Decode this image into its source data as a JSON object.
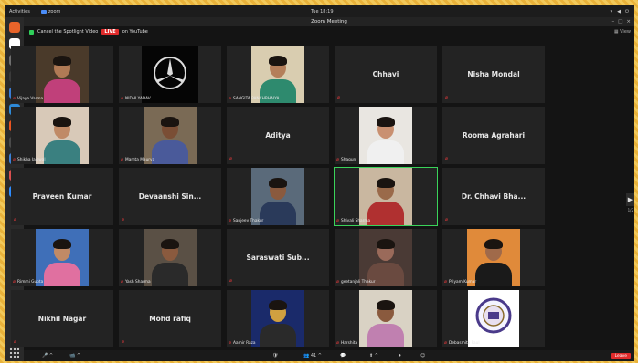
{
  "topbar": {
    "activities": "Activities",
    "app_name": "zoom",
    "clock": "Tue 18:19",
    "tray": [
      "▾",
      "◀",
      "⏻"
    ]
  },
  "window": {
    "title": "Zoom Meeting"
  },
  "spotlight_bar": {
    "cancel_label": "Cancel the Spotlight Video",
    "live_badge": "LIVE",
    "live_target": "on YouTube",
    "view_label": "▦ View"
  },
  "dock": {
    "apps": [
      {
        "name": "firefox",
        "color": "#e8642a"
      },
      {
        "name": "chrome",
        "color": "#ffffff"
      },
      {
        "name": "files",
        "color": "#6e6e6e"
      },
      {
        "name": "terminal-dark",
        "color": "#3a3a3a"
      },
      {
        "name": "thunderbird",
        "color": "#3a7bd5"
      },
      {
        "name": "document",
        "color": "#2e8ad8"
      },
      {
        "name": "software",
        "color": "#e95420"
      },
      {
        "name": "terminal",
        "color": "#4a4a4a"
      },
      {
        "name": "help",
        "color": "#3d80d6"
      },
      {
        "name": "settings",
        "color": "#d94f4f"
      },
      {
        "name": "zoom",
        "color": "#2d8cff"
      }
    ]
  },
  "participants": [
    {
      "name": "Vijaya Varma",
      "label": "Vijaya Varma",
      "has_video": true,
      "bg": "#4a3a2a",
      "skin": "#b07a55",
      "cloth": "#c0407a"
    },
    {
      "name": "NIDHI YADAV",
      "label": "NIDHI YADAV",
      "has_video": true,
      "logo": true
    },
    {
      "name": "SANGITA PANCHBHAIYA",
      "label": "SANGITA PANCHBHAIYA",
      "has_video": true,
      "bg": "#d9cdb0",
      "skin": "#b47f5a",
      "cloth": "#2e8a6e"
    },
    {
      "name": "Chhavi",
      "has_video": false
    },
    {
      "name": "Nisha Mondal",
      "has_video": false
    },
    {
      "name": "Shikha Jaiswal",
      "label": "Shikha Jaiswal",
      "has_video": true,
      "bg": "#d8c9b8",
      "skin": "#c08a66",
      "cloth": "#3a8080"
    },
    {
      "name": "Mamta Maurya",
      "label": "Mamta Maurya",
      "has_video": true,
      "bg": "#7a6a55",
      "skin": "#7a4e35",
      "cloth": "#4a5a9a"
    },
    {
      "name": "Aditya",
      "has_video": false
    },
    {
      "name": "Shagun",
      "label": "Shagun",
      "has_video": true,
      "bg": "#e9e6e1",
      "skin": "#c99070",
      "cloth": "#f0f0f0"
    },
    {
      "name": "Rooma Agrahari",
      "has_video": false
    },
    {
      "name": "Praveen Kumar",
      "has_video": false
    },
    {
      "name": "Devaanshi Sin...",
      "has_video": false
    },
    {
      "name": "Sanjeev Thakur",
      "label": "Sanjeev Thakur",
      "has_video": true,
      "bg": "#5a6a7a",
      "skin": "#8a5a3e",
      "cloth": "#2a3a5a"
    },
    {
      "name": "Shivali Sharma",
      "label": "Shivali Sharma",
      "has_video": true,
      "bg": "#c9b7a0",
      "skin": "#9a6a4a",
      "cloth": "#b03030",
      "active": true
    },
    {
      "name": "Dr. Chhavi Bha...",
      "has_video": false
    },
    {
      "name": "Rimmi Gupta",
      "label": "Rimmi Gupta",
      "has_video": true,
      "bg": "#3f6fb8",
      "skin": "#c08a66",
      "cloth": "#e070a0"
    },
    {
      "name": "Yash Sharma",
      "label": "Yash Sharma",
      "has_video": true,
      "bg": "#5a5045",
      "skin": "#8a5a3e",
      "cloth": "#2a2a2a"
    },
    {
      "name": "Saraswati Sub...",
      "has_video": false
    },
    {
      "name": "geetanjali Thakur",
      "label": "geetanjali Thakur",
      "has_video": true,
      "bg": "#4a3a35",
      "skin": "#9a6a5a",
      "cloth": "#6a4a40"
    },
    {
      "name": "Priyam Kumar",
      "label": "Priyam Kumar",
      "has_video": true,
      "bg": "#e08a3a",
      "skin": "#a06a4a",
      "cloth": "#1a1a1a"
    },
    {
      "name": "Nikhil Nagar",
      "has_video": false
    },
    {
      "name": "Mohd rafiq",
      "has_video": false
    },
    {
      "name": "Aamir Raza",
      "label": "Aamir Raza",
      "has_video": true,
      "bg": "#1a2a6a",
      "skin": "#d0a040",
      "cloth": "#2a2a2a"
    },
    {
      "name": "Harshita",
      "label": "Harshita",
      "has_video": true,
      "bg": "#d9d2c4",
      "skin": "#8a5a3e",
      "cloth": "#c080b0"
    },
    {
      "name": "Debasmita Paul",
      "label": "Debasmita Paul",
      "has_video": true,
      "seal": true
    }
  ],
  "toolbar": {
    "items": [
      "🎤 ^",
      "📹 ^",
      "🛡",
      "👥 41 ^",
      "💬",
      "⬆ ^",
      "⏺",
      "☺"
    ],
    "end_label": "Leave"
  },
  "side": {
    "arrow": "▶",
    "page": "1/2"
  },
  "colors": {
    "accent": "#2d8cff",
    "mute": "#e5393b",
    "active_border": "#3ad35a",
    "live": "#e02b2b"
  }
}
